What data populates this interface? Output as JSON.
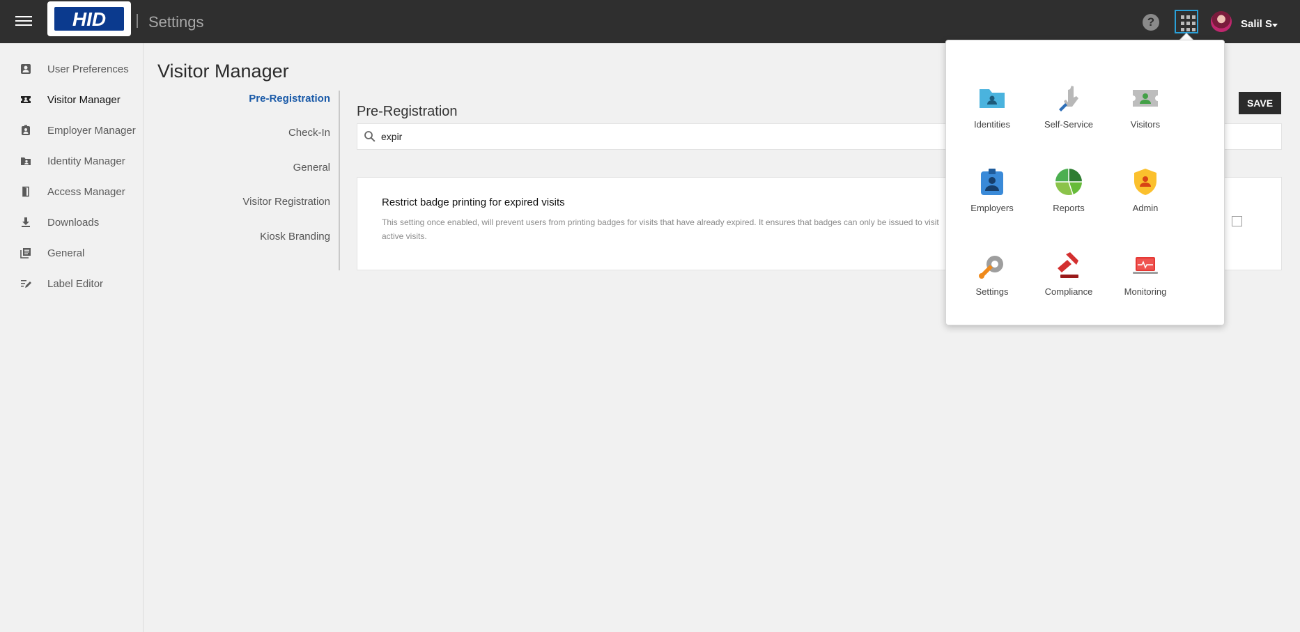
{
  "header": {
    "logo_text": "HID",
    "title": "Settings",
    "help_icon": "help-circle-icon",
    "apps_icon": "apps-grid-icon",
    "user_name": "Salil S"
  },
  "sidebar": {
    "items": [
      {
        "label": "User Preferences",
        "icon": "user-preferences-icon"
      },
      {
        "label": "Visitor Manager",
        "icon": "visitor-badge-icon"
      },
      {
        "label": "Employer Manager",
        "icon": "employer-badge-icon"
      },
      {
        "label": "Identity Manager",
        "icon": "identity-folder-icon"
      },
      {
        "label": "Access Manager",
        "icon": "door-icon"
      },
      {
        "label": "Downloads",
        "icon": "download-icon"
      },
      {
        "label": "General",
        "icon": "library-icon"
      },
      {
        "label": "Label Editor",
        "icon": "edit-list-icon"
      }
    ],
    "active": "Visitor Manager"
  },
  "main": {
    "page_title": "Visitor Manager",
    "tabs": [
      {
        "label": "Pre-Registration"
      },
      {
        "label": "Check-In"
      },
      {
        "label": "General"
      },
      {
        "label": "Visitor Registration"
      },
      {
        "label": "Kiosk Branding"
      }
    ],
    "active_tab": "Pre-Registration",
    "section_title": "Pre-Registration",
    "search_value": "expir",
    "save_label": "SAVE",
    "setting": {
      "title": "Restrict badge printing for expired visits",
      "description": "This setting once enabled, will prevent users from printing badges for visits that have already expired. It ensures that badges can only be issued to visit active visits.",
      "checked": false
    }
  },
  "launcher": {
    "apps": [
      {
        "label": "Identities",
        "icon": "identities-folder-icon"
      },
      {
        "label": "Self-Service",
        "icon": "self-service-hand-icon"
      },
      {
        "label": "Visitors",
        "icon": "visitors-badge-icon"
      },
      {
        "label": "Employers",
        "icon": "employers-badge-icon"
      },
      {
        "label": "Reports",
        "icon": "reports-pie-icon"
      },
      {
        "label": "Admin",
        "icon": "admin-shield-icon"
      },
      {
        "label": "Settings",
        "icon": "settings-wrench-icon"
      },
      {
        "label": "Compliance",
        "icon": "compliance-gavel-icon"
      },
      {
        "label": "Monitoring",
        "icon": "monitoring-laptop-icon"
      }
    ]
  },
  "colors": {
    "header_bg": "#2f2f2f",
    "accent": "#1a5aa8",
    "apps_border": "#2aa0d8"
  }
}
